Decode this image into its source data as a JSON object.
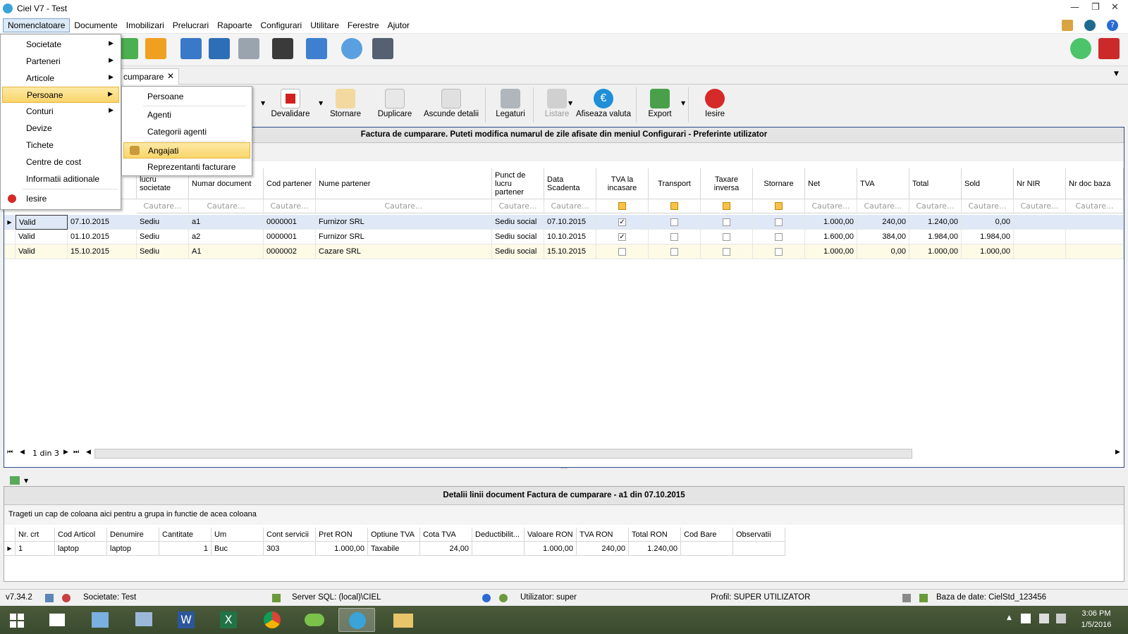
{
  "window": {
    "title": "Ciel V7 - Test"
  },
  "menubar": [
    "Nomenclatoare",
    "Documente",
    "Imobilizari",
    "Prelucrari",
    "Rapoarte",
    "Configurari",
    "Utilitare",
    "Ferestre",
    "Ajutor"
  ],
  "tab": {
    "label": "cumparare",
    "close": "✕"
  },
  "actions": [
    "Devalidare",
    "Stornare",
    "Duplicare",
    "Ascunde detalii",
    "Legaturi",
    "Listare",
    "Afiseaza valuta",
    "Export",
    "Iesire"
  ],
  "grid": {
    "title": "Factura de cumparare. Puteti modifica numarul de zile afisate din meniul Configurari - Preferinte utilizator",
    "columns": [
      "",
      "lucru societate",
      "Numar document",
      "Cod partener",
      "Nume partener",
      "Punct de lucru partener",
      "Data Scadenta",
      "TVA la incasare",
      "Transport",
      "Taxare inversa",
      "Stornare",
      "Net",
      "TVA",
      "Total",
      "Sold",
      "Nr NIR",
      "Nr doc baza"
    ],
    "filter": "Cautare...",
    "rows": [
      {
        "status": "Valid",
        "date": "07.10.2015",
        "lucru": "Sediu",
        "doc": "a1",
        "cod": "0000001",
        "nume": "Furnizor SRL",
        "punct": "Sediu social",
        "scad": "07.10.2015",
        "tva_inc": true,
        "net": "1.000,00",
        "tva": "240,00",
        "total": "1.240,00",
        "sold": "0,00"
      },
      {
        "status": "Valid",
        "date": "01.10.2015",
        "lucru": "Sediu",
        "doc": "a2",
        "cod": "0000001",
        "nume": "Furnizor SRL",
        "punct": "Sediu social",
        "scad": "10.10.2015",
        "tva_inc": true,
        "net": "1.600,00",
        "tva": "384,00",
        "total": "1.984,00",
        "sold": "1.984,00"
      },
      {
        "status": "Valid",
        "date": "15.10.2015",
        "lucru": "Sediu",
        "doc": "A1",
        "cod": "0000002",
        "nume": "Cazare SRL",
        "punct": "Sediu social",
        "scad": "15.10.2015",
        "tva_inc": false,
        "net": "1.000,00",
        "tva": "0,00",
        "total": "1.000,00",
        "sold": "1.000,00"
      }
    ],
    "pager": "1 din 3"
  },
  "details": {
    "title": "Detalii linii document Factura de cumparare - a1 din 07.10.2015",
    "group_hint": "Trageti un cap de coloana aici pentru a grupa in functie de acea coloana",
    "columns": [
      "Nr. crt",
      "Cod Articol",
      "Denumire",
      "Cantitate",
      "Um",
      "Cont servicii",
      "Pret RON",
      "Optiune TVA",
      "Cota TVA",
      "Deductibilit...",
      "Valoare RON",
      "TVA RON",
      "Total RON",
      "Cod Bare",
      "Observatii"
    ],
    "row": [
      "1",
      "laptop",
      "laptop",
      "1",
      "Buc",
      "303",
      "1.000,00",
      "Taxabile",
      "24,00",
      "",
      "1.000,00",
      "240,00",
      "1.240,00",
      "",
      ""
    ]
  },
  "status": {
    "version": "v7.34.2",
    "company": "Societate: Test",
    "server": "Server SQL: (local)\\CIEL",
    "user": "Utilizator: super",
    "profile": "Profil: SUPER UTILIZATOR",
    "db": "Baza de date: CielStd_123456"
  },
  "clock": {
    "time": "3:06 PM",
    "date": "1/5/2016"
  },
  "menu_nomenclatoare": [
    "Societate",
    "Parteneri",
    "Articole",
    "Persoane",
    "Conturi",
    "Devize",
    "Tichete",
    "Centre de cost",
    "Informatii aditionale",
    "Iesire"
  ],
  "menu_persoane": [
    "Persoane",
    "Agenti",
    "Categorii agenti",
    "Angajati",
    "Reprezentanti facturare"
  ],
  "colors": {
    "accent": "#2b4a8a",
    "highlight": "#f9d56a",
    "selected_row": "#dfe8f6",
    "alt_row": "#fdfae6"
  }
}
